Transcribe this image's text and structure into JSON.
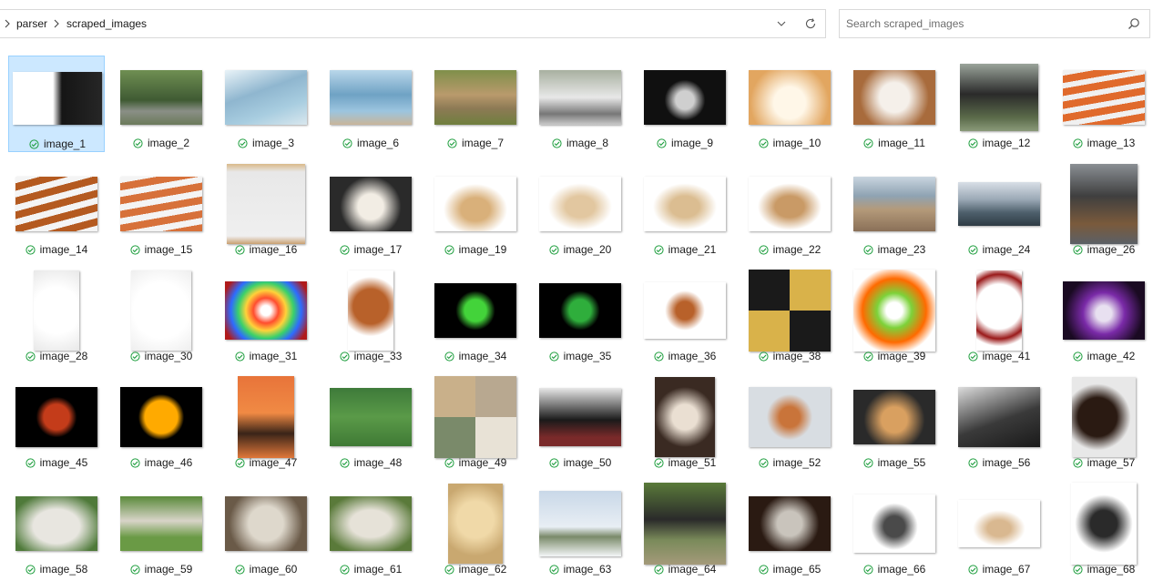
{
  "address_bar": {
    "breadcrumbs": [
      "parser",
      "scraped_images"
    ],
    "dropdown_icon": "chevron-down-icon",
    "refresh_icon": "refresh-icon"
  },
  "search": {
    "placeholder": "Search scraped_images",
    "value": "",
    "icon": "search-icon"
  },
  "status_icon": "sync-check-icon",
  "colors": {
    "selection_bg": "#cce8ff",
    "selection_border": "#99d1ff",
    "sync_green": "#1e9e3e"
  },
  "files": [
    {
      "name": "image_1",
      "selected": true,
      "w": 98,
      "h": 58,
      "bg": "linear-gradient(90deg,#ffffff 0 45%,#151515 55%,#262626)"
    },
    {
      "name": "image_2",
      "w": 90,
      "h": 60,
      "bg": "linear-gradient(180deg,#6f8f52,#3f5a33 55%,#8a8f86 75%,#6b7a5a)"
    },
    {
      "name": "image_3",
      "w": 90,
      "h": 60,
      "bg": "linear-gradient(160deg,#e9f3f8,#8fb6cf 40%,#a8cde0 70%,#d9e7ee)"
    },
    {
      "name": "image_6",
      "w": 90,
      "h": 60,
      "bg": "linear-gradient(180deg,#b9d7ea,#6fa2c4 45%,#9cc5df 75%,#c9b59a)"
    },
    {
      "name": "image_7",
      "w": 90,
      "h": 60,
      "bg": "linear-gradient(180deg,#7f8f4a,#b99a6c 45%,#8d7a55 70%,#6f7f3e)"
    },
    {
      "name": "image_8",
      "w": 90,
      "h": 60,
      "bg": "linear-gradient(180deg,#a8b0a0,#e8e8e8 50%,#777 80%,#c9c9c9)"
    },
    {
      "name": "image_9",
      "w": 90,
      "h": 60,
      "bg": "radial-gradient(circle at 50% 55%,#cfcfcf 0 18%,#101010 40%)"
    },
    {
      "name": "image_10",
      "w": 90,
      "h": 60,
      "bg": "radial-gradient(circle at 50% 60%,#fff7e8 0 30%,#e2a660 75%)"
    },
    {
      "name": "image_11",
      "w": 90,
      "h": 60,
      "bg": "radial-gradient(circle at 50% 50%,#f5f0ea 0 30%,#a86b3c 70%)"
    },
    {
      "name": "image_12",
      "w": 86,
      "h": 74,
      "bg": "linear-gradient(180deg,#9aa49a,#2a2a2a 45%,#5b6b4a 80%,#8a9a7a)"
    },
    {
      "name": "image_13",
      "w": 90,
      "h": 60,
      "bg": "repeating-linear-gradient(170deg,#f0f0f0 0 6px,#e06a2c 6px 14px)"
    },
    {
      "name": "image_14",
      "w": 90,
      "h": 60,
      "bg": "repeating-linear-gradient(165deg,#f4f4f4 0 7px,#b45a20 7px 15px)"
    },
    {
      "name": "image_15",
      "w": 90,
      "h": 60,
      "bg": "repeating-linear-gradient(170deg,#f4f4f4 0 7px,#d7713a 7px 15px)"
    },
    {
      "name": "image_16",
      "w": 86,
      "h": 88,
      "bg": "linear-gradient(180deg,#d9b98a,#e8e8e8 10%,#efefef 90%,#c9a070)"
    },
    {
      "name": "image_17",
      "w": 90,
      "h": 60,
      "bg": "radial-gradient(circle at 50% 55%,#f2ede4 0 25%,#2a2a2a 60%)"
    },
    {
      "name": "image_19",
      "w": 90,
      "h": 60,
      "bg": "radial-gradient(ellipse at 50% 60%,#d9b07a 0 25%,#ffffff 55%)"
    },
    {
      "name": "image_20",
      "w": 90,
      "h": 60,
      "bg": "radial-gradient(ellipse at 50% 55%,#e2c7a0 0 25%,#ffffff 55%)"
    },
    {
      "name": "image_21",
      "w": 90,
      "h": 60,
      "bg": "radial-gradient(ellipse at 50% 55%,#dbbd91 0 25%,#ffffff 55%)"
    },
    {
      "name": "image_22",
      "w": 90,
      "h": 60,
      "bg": "radial-gradient(ellipse at 50% 55%,#c99a66 0 25%,#ffffff 55%)"
    },
    {
      "name": "image_23",
      "w": 90,
      "h": 60,
      "bg": "linear-gradient(180deg,#c9d5df,#8fa3b3 35%,#b49a7a 60%,#8a7058)"
    },
    {
      "name": "image_24",
      "w": 90,
      "h": 48,
      "bg": "linear-gradient(180deg,#d8dee6,#9aa8b5 40%,#4d5f6b 70%,#2f3c45)"
    },
    {
      "name": "image_26",
      "w": 74,
      "h": 88,
      "bg": "linear-gradient(180deg,#8a8f94,#3f3f3f 40%,#7a5a3c 75%,#5b6066)"
    },
    {
      "name": "image_28",
      "w": 50,
      "h": 88,
      "bg": "radial-gradient(circle at 50% 50%,#ffffff 0 50%,#e8e8e8)"
    },
    {
      "name": "image_30",
      "w": 66,
      "h": 88,
      "bg": "radial-gradient(circle at 50% 50%,#ffffff 0 55%,#eeeeee)"
    },
    {
      "name": "image_31",
      "w": 90,
      "h": 64,
      "bg": "radial-gradient(circle at 50% 50%,#ffffff 0 10%,#ff4d2e 25%,#ffd23a 40%,#3ad16a 55%,#2e6bff 70%,#b01a1a 90%)"
    },
    {
      "name": "image_33",
      "w": 50,
      "h": 88,
      "bg": "radial-gradient(circle at 50% 45%,#b8612a 0 35%,#ffffff 60%)"
    },
    {
      "name": "image_34",
      "w": 90,
      "h": 60,
      "bg": "radial-gradient(circle at 50% 50%,#43d33a 0 22%,#000000 40%)"
    },
    {
      "name": "image_35",
      "w": 90,
      "h": 60,
      "bg": "radial-gradient(circle at 50% 50%,#2fae3c 0 22%,#000000 40%)"
    },
    {
      "name": "image_36",
      "w": 90,
      "h": 62,
      "bg": "radial-gradient(circle at 50% 50%,#b8612a 0 18%,#ffffff 40%)"
    },
    {
      "name": "image_38",
      "w": 90,
      "h": 90,
      "bg": "repeating-conic-gradient(#d9b24a 0 25%,#1a1a1a 0 50%)"
    },
    {
      "name": "image_39",
      "w": 90,
      "h": 90,
      "bg": "radial-gradient(circle at 50% 50%,#ffffff 0 14%,#7dd23a 30%,#ff6a00 55%,#ffffff 75%)"
    },
    {
      "name": "image_41",
      "w": 50,
      "h": 88,
      "bg": "radial-gradient(circle at 50% 45%,#ffffff 0 45%,#9a1a1a 65%,#ffffff 80%)"
    },
    {
      "name": "image_42",
      "w": 90,
      "h": 64,
      "bg": "radial-gradient(circle at 50% 55%,#e8e0f0 0 15%,#7a2aa8 40%,#1a0a22 75%)"
    },
    {
      "name": "image_45",
      "w": 90,
      "h": 66,
      "bg": "radial-gradient(circle at 50% 50%,#c43c1a 0 25%,#000000 40%)"
    },
    {
      "name": "image_46",
      "w": 90,
      "h": 66,
      "bg": "radial-gradient(circle at 50% 50%,#ffaa00 0 32%,#000000 45%)"
    },
    {
      "name": "image_47",
      "w": 62,
      "h": 90,
      "bg": "linear-gradient(180deg,#e8743a,#f08a44 45%,#3a2418 70%,#e0783a)"
    },
    {
      "name": "image_48",
      "w": 90,
      "h": 64,
      "bg": "linear-gradient(180deg,#3e7a3a,#5a9a48 50%,#3f7a35)"
    },
    {
      "name": "image_49",
      "w": 90,
      "h": 90,
      "bg": "conic-gradient(#b8a890 0 25%,#e8e2d6 0 50%,#7a8a6a 0 75%,#c9b08a 0)"
    },
    {
      "name": "image_50",
      "w": 90,
      "h": 64,
      "bg": "linear-gradient(180deg,#e8e8e8,#1a1a1a 55%,#7a2a2a 85%)"
    },
    {
      "name": "image_51",
      "w": 66,
      "h": 88,
      "bg": "radial-gradient(circle at 50% 50%,#eadfd2 0 25%,#3a2a22 60%)"
    },
    {
      "name": "image_52",
      "w": 90,
      "h": 66,
      "bg": "radial-gradient(circle at 50% 50%,#c9743a 0 20%,#d8dde2 45%)"
    },
    {
      "name": "image_55",
      "w": 90,
      "h": 60,
      "bg": "radial-gradient(circle at 50% 55%,#d9a060 0 25%,#2a2a2a 60%)"
    },
    {
      "name": "image_56",
      "w": 90,
      "h": 66,
      "bg": "linear-gradient(160deg,#dcdcdc,#3a3a3a 55%,#1a1a1a)"
    },
    {
      "name": "image_57",
      "w": 70,
      "h": 88,
      "bg": "radial-gradient(circle at 40% 50%,#2a1a12 0 35%,#e8e8e8 60%)"
    },
    {
      "name": "image_58",
      "w": 90,
      "h": 60,
      "bg": "radial-gradient(ellipse at 50% 55%,#e8e6e0 0 40%,#4f7a3a 80%)"
    },
    {
      "name": "image_59",
      "w": 90,
      "h": 60,
      "bg": "linear-gradient(180deg,#5a8a3a,#d8d4c8 45%,#6a9a45 75%)"
    },
    {
      "name": "image_60",
      "w": 90,
      "h": 60,
      "bg": "radial-gradient(circle at 50% 50%,#ded8cc 0 35%,#6a5a48 75%)"
    },
    {
      "name": "image_61",
      "w": 90,
      "h": 60,
      "bg": "radial-gradient(ellipse at 50% 50%,#e6e2d8 0 35%,#5a7a3a 80%)"
    },
    {
      "name": "image_62",
      "w": 60,
      "h": 88,
      "bg": "radial-gradient(circle at 50% 45%,#f0d9a8 0 35%,#c9a870 70%)"
    },
    {
      "name": "image_63",
      "w": 90,
      "h": 72,
      "bg": "linear-gradient(180deg,#c9d8e8,#e8eef4 55%,#7a8a6a 70%,#f4f6f8)"
    },
    {
      "name": "image_64",
      "w": 90,
      "h": 90,
      "bg": "linear-gradient(180deg,#5a7a3a,#2a2a2a 45%,#7a8a5a 70%,#a49a7a)"
    },
    {
      "name": "image_65",
      "w": 90,
      "h": 60,
      "bg": "radial-gradient(circle at 50% 50%,#c9c4bc 0 25%,#2a1a12 60%)"
    },
    {
      "name": "image_66",
      "w": 90,
      "h": 64,
      "bg": "radial-gradient(circle at 50% 55%,#4a4a4a 0 20%,#ffffff 45%)"
    },
    {
      "name": "image_67",
      "w": 90,
      "h": 52,
      "bg": "radial-gradient(ellipse at 50% 60%,#d9b890 0 20%,#ffffff 45%)"
    },
    {
      "name": "image_68",
      "w": 72,
      "h": 90,
      "bg": "radial-gradient(circle at 50% 50%,#2a2a2a 0 25%,#ffffff 55%)"
    }
  ]
}
